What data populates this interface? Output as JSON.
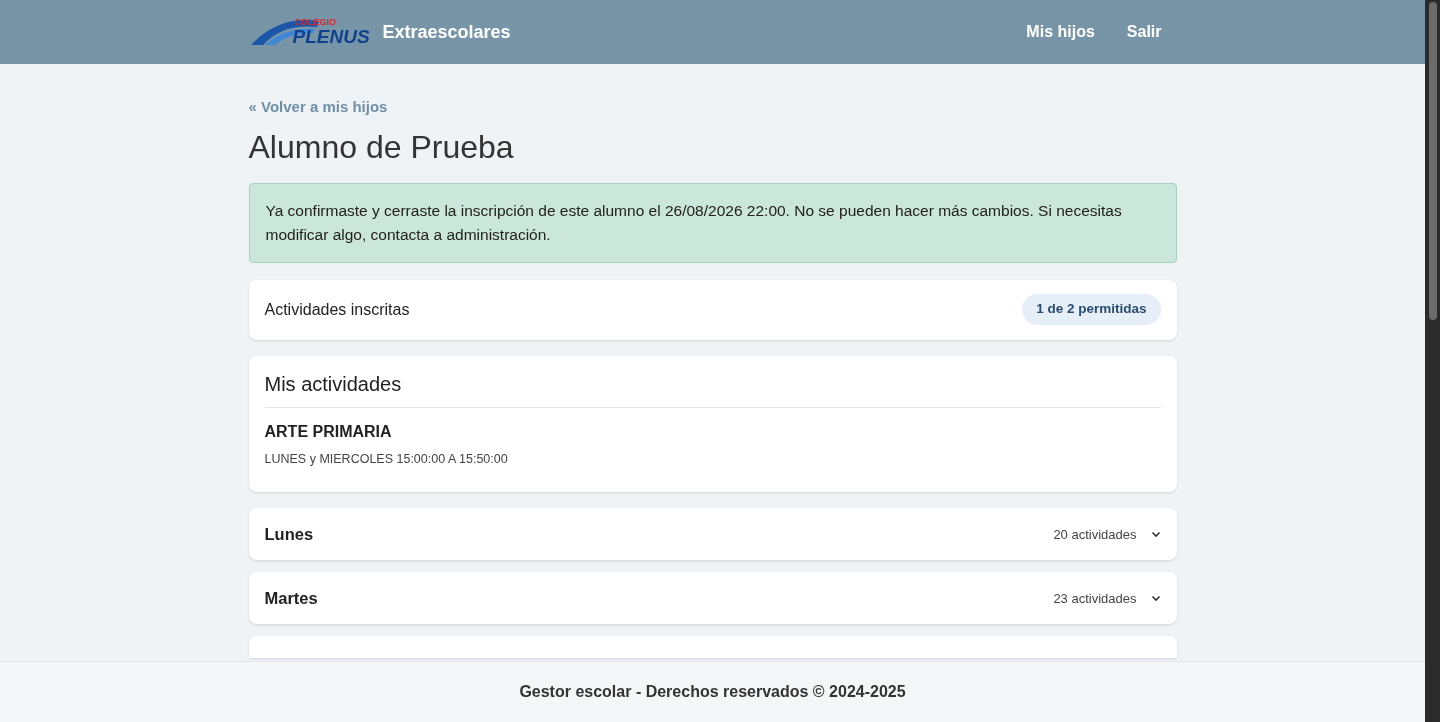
{
  "header": {
    "logo": {
      "top": "COLEGIO",
      "main": "PLENUS"
    },
    "title": "Extraescolares",
    "nav": [
      "Mis hijos",
      "Salir"
    ]
  },
  "back_link": "« Volver a mis hijos",
  "student_name": "Alumno de Prueba",
  "alert": "Ya confirmaste y cerraste la inscripción de este alumno el 26/08/2026 22:00. No se pueden hacer más cambios. Si necesitas modificar algo, contacta a administración.",
  "enrolled": {
    "label": "Actividades inscritas",
    "badge": "1 de 2 permitidas"
  },
  "my_activities": {
    "title": "Mis actividades",
    "items": [
      {
        "name": "ARTE PRIMARIA",
        "schedule": "LUNES y MIERCOLES 15:00:00 A 15:50:00"
      }
    ]
  },
  "days": [
    {
      "name": "Lunes",
      "count": "20 actividades",
      "expanded": false
    },
    {
      "name": "Martes",
      "count": "23 actividades",
      "expanded": false
    }
  ],
  "footer": "Gestor escolar - Derechos reservados © 2024-2025"
}
